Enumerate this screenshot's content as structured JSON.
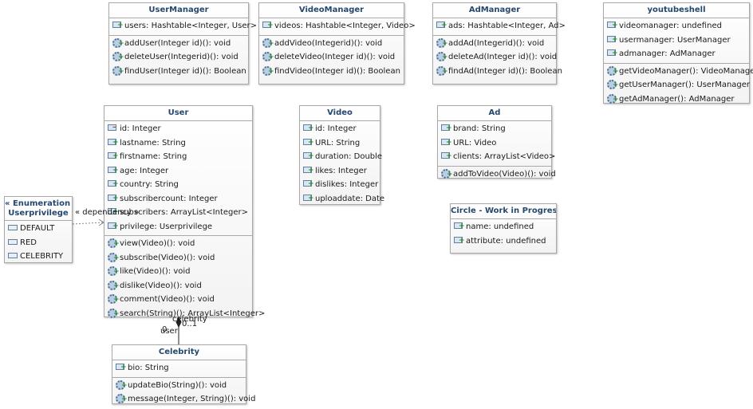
{
  "classes": {
    "usermanager": {
      "name": "UserManager",
      "attributes": [
        "users: Hashtable<Integer, User>"
      ],
      "operations": [
        "addUser(Integer id)(): void",
        "deleteUser(Integerid)(): void",
        "findUser(Integer id)(): Boolean"
      ]
    },
    "videomanager": {
      "name": "VideoManager",
      "attributes": [
        "videos: Hashtable<Integer, Video>"
      ],
      "operations": [
        "addVideo(Integerid)(): void",
        "deleteVideo(Integer id)(): void",
        "findVideo(Integer id)(): Boolean"
      ]
    },
    "admanager": {
      "name": "AdManager",
      "attributes": [
        "ads: Hashtable<Integer, Ad>"
      ],
      "operations": [
        "addAd(Integerid)(): void",
        "deleteAd(Integer id)(): void",
        "findAd(Integer id)(): Boolean"
      ]
    },
    "youtubeshell": {
      "name": "youtubeshell",
      "attributes": [
        "videomanager: undefined",
        "usermanager: UserManager",
        "admanager: AdManager"
      ],
      "operations": [
        "getVideoManager(): VideoManager",
        "getUserManager(): UserManager",
        "getAdManager(): AdManager"
      ]
    },
    "user": {
      "name": "User",
      "attributes": [
        "id: Integer",
        "lastname: String",
        "firstname: String",
        "age: Integer",
        "country: String",
        "subscribercount: Integer",
        "subscribers: ArrayList<Integer>",
        "privilege: Userprivilege"
      ],
      "operations": [
        "view(Video)(): void",
        "subscribe(Video)(): void",
        "like(Video)(): void",
        "dislike(Video)(): void",
        "comment(Video)(): void",
        "search(String)(): ArrayList<Integer>"
      ]
    },
    "video": {
      "name": "Video",
      "attributes": [
        "id: Integer",
        "URL: String",
        "duration: Double",
        "likes: Integer",
        "dislikes: Integer",
        "uploaddate: Date"
      ]
    },
    "ad": {
      "name": "Ad",
      "attributes": [
        "brand: String",
        "URL: Video",
        "clients: ArrayList<Video>"
      ],
      "operations": [
        "addToVideo(Video)(): void"
      ]
    },
    "circle": {
      "name": "Circle - Work in Progress",
      "attributes": [
        "name: undefined",
        "attribute: undefined"
      ]
    },
    "celebrity": {
      "name": "Celebrity",
      "attributes": [
        "bio: String"
      ],
      "operations": [
        "updateBio(String)(): void",
        "message(Integer, String)(): void"
      ]
    }
  },
  "enumeration": {
    "stereotype": "« Enumeration »",
    "name": "Userprivilege",
    "literals": [
      "DEFAULT",
      "RED",
      "CELEBRITY"
    ]
  },
  "relations": {
    "dependency_label": "« dependency »",
    "role_celebrity": "celebrity",
    "mult_celebrity": "0..1",
    "role_user": "user",
    "mult_user": "0"
  },
  "colors": {
    "header_text": "#25486e",
    "border": "#a9a9a9"
  }
}
